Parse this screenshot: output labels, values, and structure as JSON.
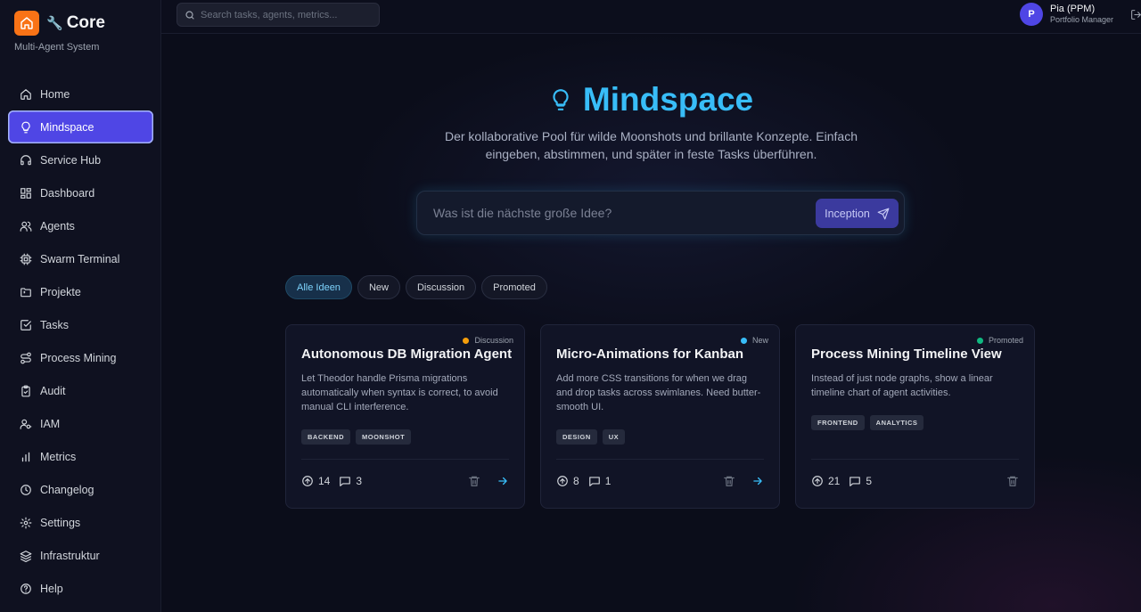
{
  "brand": {
    "title": "Core",
    "subtitle": "Multi-Agent System"
  },
  "sidebar": {
    "items": [
      {
        "label": "Home",
        "icon": "home-icon"
      },
      {
        "label": "Mindspace",
        "icon": "lightbulb-icon",
        "active": true
      },
      {
        "label": "Service Hub",
        "icon": "headset-icon"
      },
      {
        "label": "Dashboard",
        "icon": "dashboard-icon"
      },
      {
        "label": "Agents",
        "icon": "users-icon"
      },
      {
        "label": "Swarm Terminal",
        "icon": "cpu-icon"
      },
      {
        "label": "Projekte",
        "icon": "folder-icon"
      },
      {
        "label": "Tasks",
        "icon": "checkbox-icon"
      },
      {
        "label": "Process Mining",
        "icon": "route-icon"
      },
      {
        "label": "Audit",
        "icon": "clipboard-icon"
      },
      {
        "label": "IAM",
        "icon": "user-key-icon"
      },
      {
        "label": "Metrics",
        "icon": "bar-chart-icon"
      },
      {
        "label": "Changelog",
        "icon": "clock-icon"
      },
      {
        "label": "Settings",
        "icon": "gear-icon"
      },
      {
        "label": "Infrastruktur",
        "icon": "layers-icon"
      },
      {
        "label": "Help",
        "icon": "help-icon"
      }
    ]
  },
  "topbar": {
    "search_placeholder": "Search tasks, agents, metrics...",
    "user": {
      "initial": "P",
      "name": "Pia (PPM)",
      "role": "Portfolio Manager"
    }
  },
  "hero": {
    "title": "Mindspace",
    "subtitle": "Der kollaborative Pool für wilde Moonshots und brillante Konzepte. Einfach eingeben, abstimmen, und später in feste Tasks überführen."
  },
  "idea_input": {
    "placeholder": "Was ist die nächste große Idee?",
    "button_label": "Inception"
  },
  "filters": [
    {
      "label": "Alle Ideen",
      "active": true
    },
    {
      "label": "New"
    },
    {
      "label": "Discussion"
    },
    {
      "label": "Promoted"
    }
  ],
  "cards": [
    {
      "status": "Discussion",
      "status_color": "#f59e0b",
      "title": "Autonomous DB Migration Agent",
      "description": "Let Theodor handle Prisma migrations automatically when syntax is correct, to avoid manual CLI interference.",
      "tags": [
        "BACKEND",
        "MOONSHOT"
      ],
      "upvotes": "14",
      "comments": "3",
      "has_promote": true
    },
    {
      "status": "New",
      "status_color": "#38bdf8",
      "title": "Micro-Animations for Kanban",
      "description": "Add more CSS transitions for when we drag and drop tasks across swimlanes. Need butter-smooth UI.",
      "tags": [
        "DESIGN",
        "UX"
      ],
      "upvotes": "8",
      "comments": "1",
      "has_promote": true
    },
    {
      "status": "Promoted",
      "status_color": "#10b981",
      "title": "Process Mining Timeline View",
      "description": "Instead of just node graphs, show a linear timeline chart of agent activities.",
      "tags": [
        "FRONTEND",
        "ANALYTICS"
      ],
      "upvotes": "21",
      "comments": "5",
      "has_promote": false
    }
  ]
}
